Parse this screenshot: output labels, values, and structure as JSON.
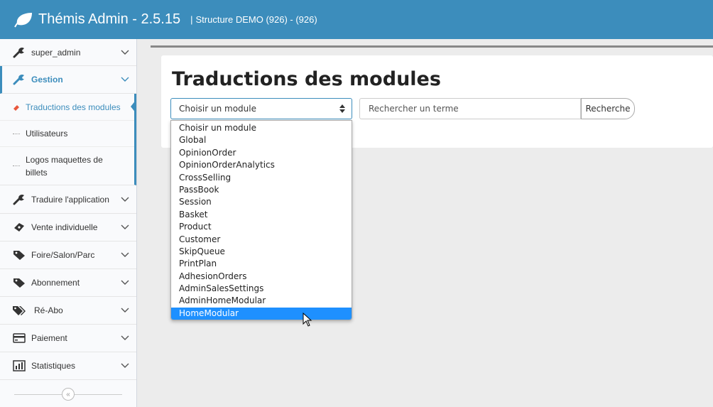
{
  "header": {
    "app_title": "Thémis Admin - 2.5.15",
    "separator": "|",
    "structure": "Structure DEMO (926) - (926)",
    "logo_icon": "leaf-icon",
    "color": "#3c8dbc"
  },
  "sidebar": {
    "items": [
      {
        "label": "super_admin",
        "icon": "wrench-icon"
      },
      {
        "label": "Gestion",
        "icon": "wrench-icon"
      },
      {
        "label": "Traduire l'application",
        "icon": "wrench-icon"
      },
      {
        "label": "Vente individuelle",
        "icon": "ticket-icon"
      },
      {
        "label": "Foire/Salon/Parc",
        "icon": "tag-icon"
      },
      {
        "label": "Abonnement",
        "icon": "tag-icon"
      },
      {
        "label": "Ré-Abo",
        "icon": "tags-icon"
      },
      {
        "label": "Paiement",
        "icon": "credit-card-icon"
      },
      {
        "label": "Statistiques",
        "icon": "bar-chart-icon"
      }
    ],
    "submenu": [
      {
        "label": "Traductions des modules"
      },
      {
        "label": "Utilisateurs"
      },
      {
        "label": "Logos maquettes de billets"
      }
    ],
    "collapse_glyph": "«"
  },
  "main": {
    "title": "Traductions des modules",
    "select_value": "Choisir un module",
    "search_placeholder": "Rechercher un terme",
    "search_button": "Recherche",
    "options": [
      "Choisir un module",
      "Global",
      "OpinionOrder",
      "OpinionOrderAnalytics",
      "CrossSelling",
      "PassBook",
      "Session",
      "Basket",
      "Product",
      "Customer",
      "SkipQueue",
      "PrintPlan",
      "AdhesionOrders",
      "AdminSalesSettings",
      "AdminHomeModular",
      "HomeModular"
    ],
    "highlighted_option": "HomeModular",
    "highlight_color": "#1e90ff"
  }
}
